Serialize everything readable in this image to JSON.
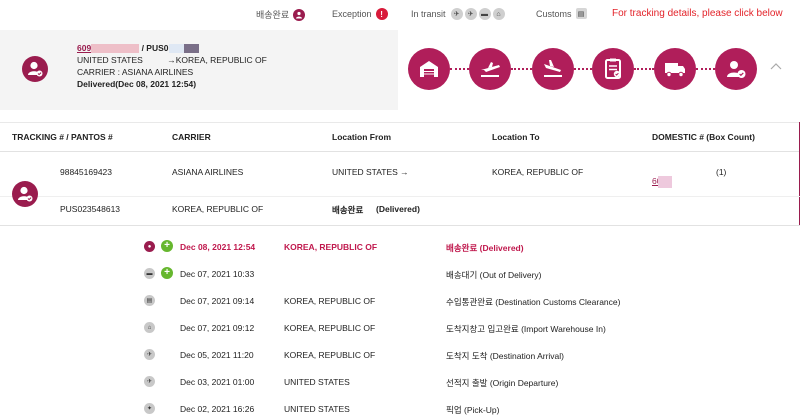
{
  "legend": {
    "delivered_label": "배송완료",
    "exception_label": "Exception",
    "exception_badge": "!",
    "transit_label": "In transit",
    "customs_label": "Customs",
    "click_message": "For tracking details, please click below"
  },
  "summary": {
    "tracking_prefix": "609",
    "pantos_prefix": "/ PUS0",
    "origin": "UNITED STATES",
    "destination": "→KOREA, REPUBLIC OF",
    "carrier_line": "CARRIER : ASIANA AIRLINES",
    "status_line": "Delivered(Dec 08, 2021 12:54)"
  },
  "steps": [
    "warehouse-icon",
    "departure-icon",
    "arrival-icon",
    "customs-icon",
    "truck-icon",
    "delivered-icon"
  ],
  "table": {
    "headers": [
      "TRACKING # / PANTOS #",
      "CARRIER",
      "Location From",
      "Location To",
      "DOMESTIC # (Box Count)"
    ],
    "row1": {
      "tracking": "98845169423",
      "carrier": "ASIANA AIRLINES",
      "from": "UNITED STATES →",
      "to": "KOREA, REPUBLIC OF",
      "domestic": "6094",
      "count": "(1)"
    },
    "row2": {
      "pantos": "PUS023548613",
      "carrier": "KOREA, REPUBLIC OF",
      "status_ko": "배송완료",
      "status_en": "(Delivered)"
    }
  },
  "history": [
    {
      "date": "Dec 08, 2021 12:54",
      "location": "KOREA, REPUBLIC OF",
      "status": "배송완료 (Delivered)",
      "current": true
    },
    {
      "date": "Dec 07, 2021 10:33",
      "location": "",
      "status": "배송대기 (Out of Delivery)",
      "current": false
    },
    {
      "date": "Dec 07, 2021 09:14",
      "location": "KOREA, REPUBLIC OF",
      "status": "수입통관완료 (Destination Customs Clearance)",
      "current": false
    },
    {
      "date": "Dec 07, 2021 09:12",
      "location": "KOREA, REPUBLIC OF",
      "status": "도착지창고 입고완료 (Import Warehouse In)",
      "current": false
    },
    {
      "date": "Dec 05, 2021 11:20",
      "location": "KOREA, REPUBLIC OF",
      "status": "도착지 도착 (Destination Arrival)",
      "current": false
    },
    {
      "date": "Dec 03, 2021 01:00",
      "location": "UNITED STATES",
      "status": "선적지 출발 (Origin Departure)",
      "current": false
    },
    {
      "date": "Dec 02, 2021 16:26",
      "location": "UNITED STATES",
      "status": "픽업 (Pick-Up)",
      "current": false
    }
  ],
  "colors": {
    "brand": "#9a1c4e",
    "step": "#b01e5a",
    "alert": "#e3232a",
    "plus": "#66b72e"
  }
}
